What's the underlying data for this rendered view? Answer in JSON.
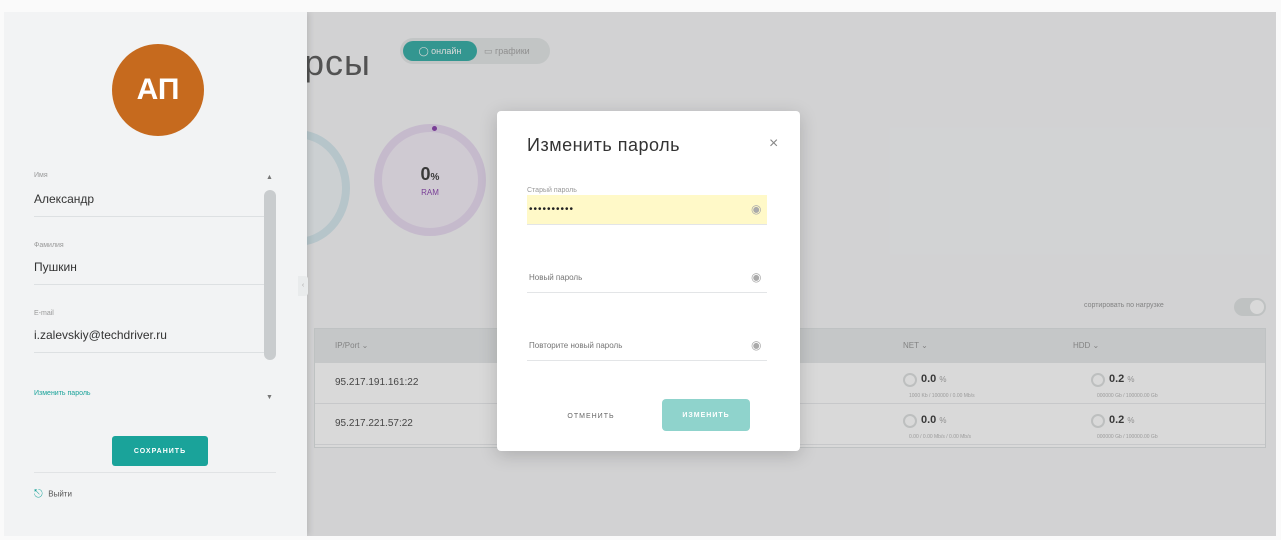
{
  "main": {
    "title": "рсы",
    "toggle_online": "◯ онлайн",
    "toggle_graph": "▭ графики",
    "gauge_ram": {
      "value": "0",
      "unit": "%",
      "label": "RAM"
    },
    "sort_label": "сортировать по нагрузке",
    "table": {
      "headers": {
        "ip": "IP/Port ⌄",
        "net": "NET ⌄",
        "hdd": "HDD ⌄"
      },
      "rows": [
        {
          "ip": "95.217.191.161:22",
          "net_value": "0.0",
          "net_unit": "%",
          "net_sub": "1000 Kb / 100000 / 0.00 Mb/s",
          "hdd_value": "0.2",
          "hdd_unit": "%",
          "hdd_sub": "000000 Gb / 100000.00 Gb"
        },
        {
          "ip": "95.217.221.57:22",
          "net_value": "0.0",
          "net_unit": "%",
          "net_sub": "0.00 / 0.00 Mb/s / 0.00 Mb/s",
          "hdd_value": "0.2",
          "hdd_unit": "%",
          "hdd_sub": "000000 Gb / 100000.00 Gb"
        }
      ]
    }
  },
  "panel": {
    "initials": "АП",
    "name_label": "Имя",
    "name_value": "Александр",
    "surname_label": "Фамилия",
    "surname_value": "Пушкин",
    "email_label": "E-mail",
    "email_value": "i.zalevskiy@techdriver.ru",
    "change_password_link": "Изменить пароль",
    "save_label": "СОХРАНИТЬ",
    "logout_label": "Выйти",
    "scroll_up": "▲",
    "scroll_down": "▼",
    "collapse": "‹"
  },
  "modal": {
    "title": "Изменить пароль",
    "close": "×",
    "old_label": "Старый пароль",
    "old_value": "••••••••••",
    "new_placeholder": "Новый пароль",
    "repeat_placeholder": "Повторите новый пароль",
    "cancel_label": "ОТМЕНИТЬ",
    "submit_label": "ИЗМЕНИТЬ"
  },
  "icons": {
    "eye": "eye-icon",
    "logout": "logout-icon",
    "close": "close-icon"
  },
  "colors": {
    "accent": "#1aa39a",
    "avatar": "#c66a1e",
    "ram": "#7a2aa3",
    "autofill": "#fff9c8"
  }
}
